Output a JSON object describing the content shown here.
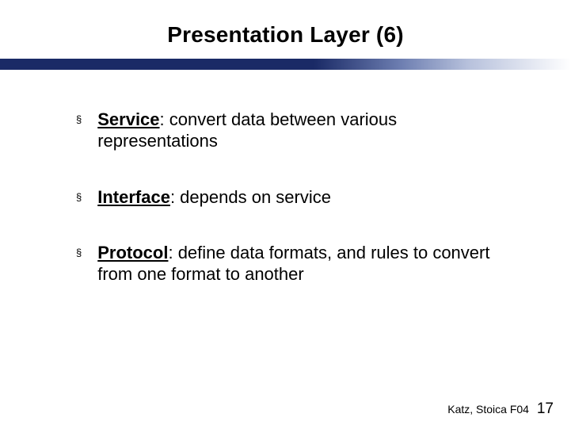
{
  "title": "Presentation Layer (6)",
  "bullets": [
    {
      "label": "Service",
      "rest": ": convert data between various representations"
    },
    {
      "label": "Interface",
      "rest": ": depends on service"
    },
    {
      "label": "Protocol",
      "rest": ": define data formats, and rules to convert from one format to another"
    }
  ],
  "footer": {
    "credit": "Katz, Stoica F04",
    "page": "17"
  }
}
